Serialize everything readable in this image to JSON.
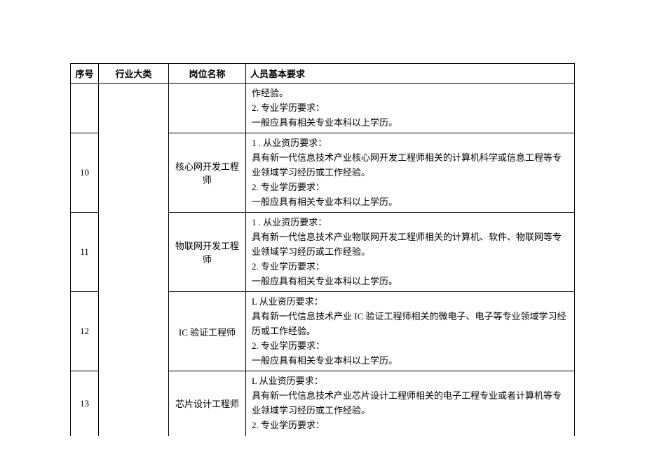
{
  "headers": {
    "seq": "序号",
    "category": "行业大类",
    "position": "岗位名称",
    "requirement": "人员基本要求"
  },
  "rows": [
    {
      "seq": "",
      "position": "",
      "requirement": "作经验。\n2. 专业学历要求：\n一般应具有相关专业本科以上学历。"
    },
    {
      "seq": "10",
      "position": "核心网开发工程师",
      "requirement": "1      . 从业资历要求：\n具有新一代信息技术产业核心网开发工程师相关的计算机科学或信息工程等专业领域学习经历或工作经验。\n2. 专业学历要求：\n一般应具有相关专业本科以上学历。"
    },
    {
      "seq": "11",
      "position": "物联网开发工程师",
      "requirement": "1      . 从业资历要求：\n具有新一代信息技术产业物联网开发工程师相关的计算机、软件、物联网等专业领域学习经历或工作经验。\n2. 专业学历要求：\n一般应具有相关专业本科以上学历。"
    },
    {
      "seq": "12",
      "position": "IC 验证工程师",
      "requirement": "L 从业资历要求：\n具有新一代信息技术产业 IC 验证工程师相关的微电子、电子等专业领域学习经历或工作经验。\n2. 专业学历要求：\n一般应具有相关专业本科以上学历。"
    },
    {
      "seq": "13",
      "position": "芯片设计工程师",
      "requirement": "L 从业资历要求：\n具有新一代信息技术产业芯片设计工程师相关的电子工程专业或者计算机等专业领域学习经历或工作经验。\n2. 专业学历要求："
    }
  ]
}
